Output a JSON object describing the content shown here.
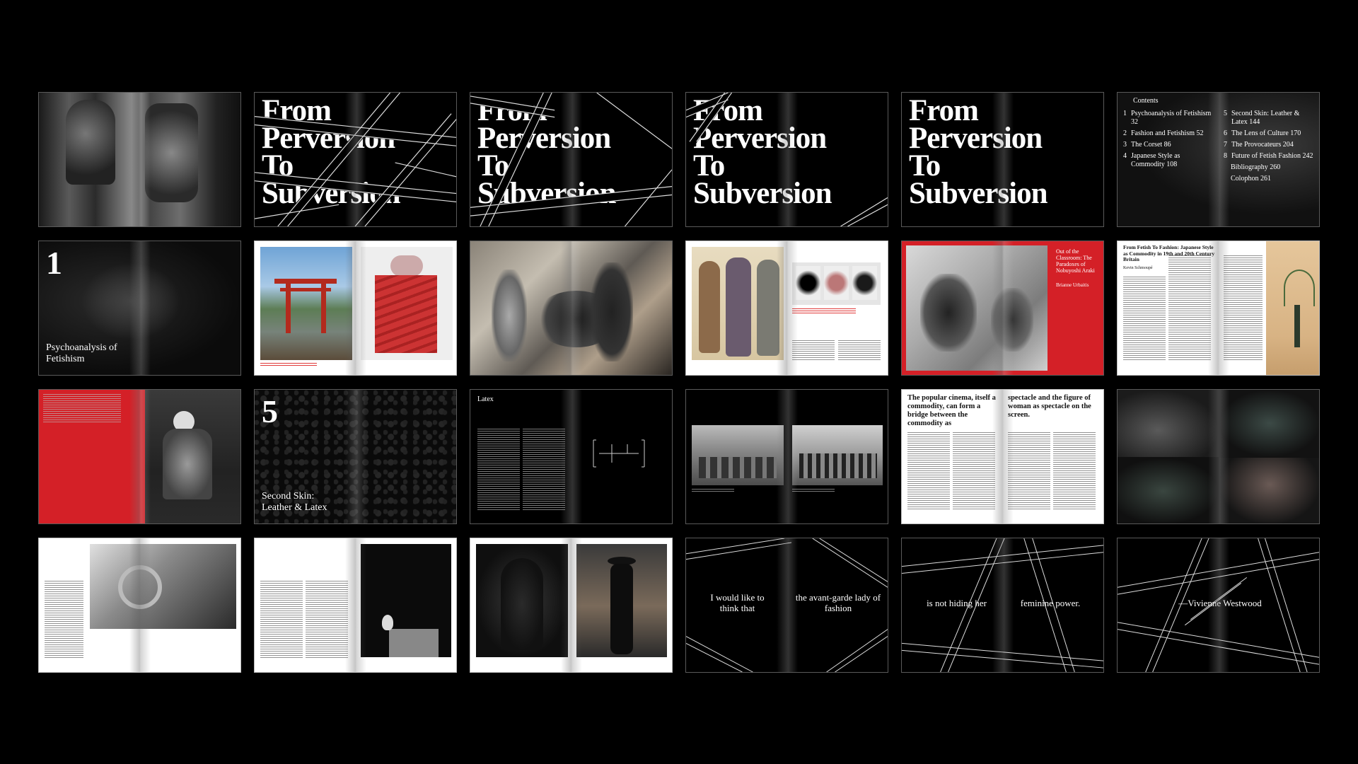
{
  "spreads": {
    "r1c2": {
      "title": "From Perversion To Subversion"
    },
    "r1c3": {
      "title": "From Perversion To Subversion"
    },
    "r1c4": {
      "title": "From Perversion To Subversion"
    },
    "r1c5": {
      "title": "From Perversion To Subversion"
    },
    "contents": {
      "heading": "Contents",
      "left": [
        {
          "num": "1",
          "label": "Psychoanalysis of Fetishism 32"
        },
        {
          "num": "2",
          "label": "Fashion and Fetishism 52"
        },
        {
          "num": "3",
          "label": "The Corset 86"
        },
        {
          "num": "4",
          "label": "Japanese Style as Commodity 108"
        }
      ],
      "right": [
        {
          "num": "5",
          "label": "Second Skin: Leather & Latex 144"
        },
        {
          "num": "6",
          "label": "The Lens of Culture 170"
        },
        {
          "num": "7",
          "label": "The Provocateurs 204"
        },
        {
          "num": "8",
          "label": "Future of Fetish Fashion 242"
        },
        {
          "num": "",
          "label": "Bibliography 260"
        },
        {
          "num": "",
          "label": "Colophon 261"
        }
      ]
    },
    "chapter1": {
      "number": "1",
      "title": "Psychoanalysis of Fetishism"
    },
    "araki": {
      "title": "Out of the Classroom: The Paradoxes of Nobuyoshi Araki",
      "author": "Brianne Urbaitis"
    },
    "japanese": {
      "title": "From Fetish To Fashion: Japanese Style as Commodity in 19th and 20th Century Britain",
      "author": "Kevin Schmoupé"
    },
    "chapter5": {
      "number": "5",
      "title": "Second Skin: Leather & Latex"
    },
    "latex": {
      "heading": "Latex"
    },
    "cinema": {
      "left": "The popular cinema, itself a commodity, can form a bridge between the commodity as",
      "right": "spectacle and the figure of woman as spectacle on the screen."
    },
    "quote1": {
      "left": "I would like to think that",
      "right": "the avant-garde lady of fashion"
    },
    "quote2": {
      "left": "is not hiding her",
      "right": "feminine power."
    },
    "quote3": {
      "text": "—Vivienne Westwood"
    }
  },
  "colors": {
    "accent_red": "#d42027",
    "background": "#000000",
    "line": "#bdbdbd"
  }
}
